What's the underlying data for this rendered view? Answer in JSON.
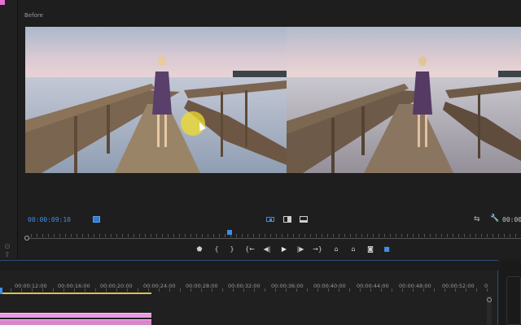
{
  "monitor": {
    "label": "Before",
    "timecode": "00:00:09:10",
    "duration": "00:00"
  },
  "colors": {
    "accent": "#3d8ee6",
    "clip": "#e89be0",
    "work_area": "#d8c44a",
    "cursor_highlight": "#f0dc28"
  },
  "icons": {
    "fit": "fit-icon",
    "compare": "compare-view-icon",
    "side_by_side": "side-by-side-icon",
    "split": "split-view-icon",
    "swap": "swap-icon",
    "wrench": "wrench-icon"
  },
  "transport": [
    {
      "name": "add-marker-button",
      "glyph": "⬟"
    },
    {
      "name": "mark-in-button",
      "glyph": "{"
    },
    {
      "name": "mark-out-button",
      "glyph": "}"
    },
    {
      "name": "go-to-in-button",
      "glyph": "{←"
    },
    {
      "name": "step-back-button",
      "glyph": "◀|"
    },
    {
      "name": "play-button",
      "glyph": "▶"
    },
    {
      "name": "step-forward-button",
      "glyph": "|▶"
    },
    {
      "name": "go-to-out-button",
      "glyph": "→}"
    },
    {
      "name": "lift-button",
      "glyph": "⌂"
    },
    {
      "name": "extract-button",
      "glyph": "⌂"
    },
    {
      "name": "export-frame-button",
      "glyph": "◙"
    },
    {
      "name": "comparison-view-button",
      "glyph": "■"
    }
  ],
  "timeline": {
    "ruler": [
      "00:00:12:00",
      "00:00:16:00",
      "00:00:20:00",
      "00:00:24:00",
      "00:00:28:00",
      "00:00:32:00",
      "00:00:36:00",
      "00:00:40:00",
      "00:00:44:00",
      "00:00:48:00",
      "00:00:52:00",
      "0"
    ]
  }
}
